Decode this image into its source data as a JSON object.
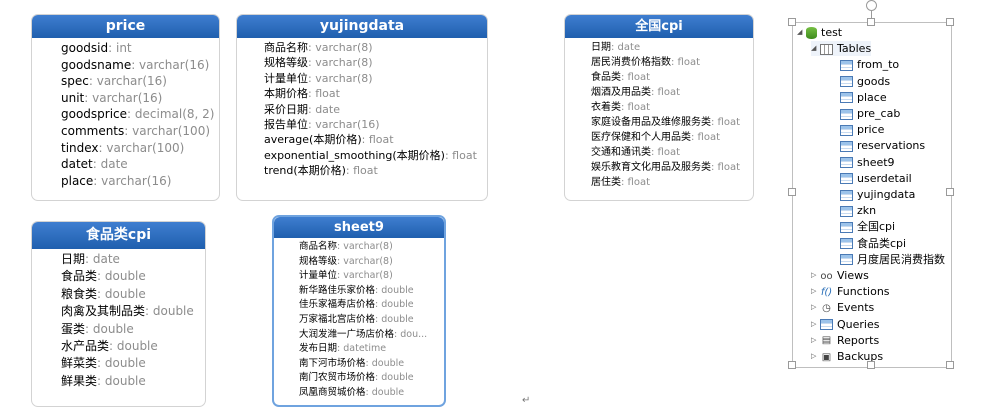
{
  "tables": {
    "price": {
      "title": "price",
      "rows": [
        {
          "n": "goodsid",
          "t": ": int"
        },
        {
          "n": "goodsname",
          "t": ": varchar(16)"
        },
        {
          "n": "spec",
          "t": ": varchar(16)"
        },
        {
          "n": "unit",
          "t": ": varchar(16)"
        },
        {
          "n": "goodsprice",
          "t": ": decimal(8, 2)"
        },
        {
          "n": "comments",
          "t": ": varchar(100)"
        },
        {
          "n": "tindex",
          "t": ": varchar(100)"
        },
        {
          "n": "datet",
          "t": ": date"
        },
        {
          "n": "place",
          "t": ": varchar(16)"
        }
      ]
    },
    "yujingdata": {
      "title": "yujingdata",
      "rows": [
        {
          "n": "商品名称",
          "t": ": varchar(8)"
        },
        {
          "n": "规格等级",
          "t": ": varchar(8)"
        },
        {
          "n": "计量单位",
          "t": ": varchar(8)"
        },
        {
          "n": "本期价格",
          "t": ": float"
        },
        {
          "n": "采价日期",
          "t": ": date"
        },
        {
          "n": "报告单位",
          "t": ": varchar(16)"
        },
        {
          "n": "average(本期价格)",
          "t": ": float"
        },
        {
          "n": "exponential_smoothing(本期价格)",
          "t": ": float"
        },
        {
          "n": "trend(本期价格)",
          "t": ": float"
        }
      ]
    },
    "cpi": {
      "title": "全国cpi",
      "rows": [
        {
          "n": "日期",
          "t": ": date"
        },
        {
          "n": "居民消费价格指数",
          "t": ": float"
        },
        {
          "n": "食品类",
          "t": ": float"
        },
        {
          "n": "烟酒及用品类",
          "t": ": float"
        },
        {
          "n": "衣着类",
          "t": ": float"
        },
        {
          "n": "家庭设备用品及维修服务类",
          "t": ": float"
        },
        {
          "n": "医疗保健和个人用品类",
          "t": ": float"
        },
        {
          "n": "交通和通讯类",
          "t": ": float"
        },
        {
          "n": "娱乐教育文化用品及服务类",
          "t": ": float"
        },
        {
          "n": "居住类",
          "t": ": float"
        }
      ]
    },
    "foodcpi": {
      "title": "食品类cpi",
      "rows": [
        {
          "n": "日期",
          "t": ": date"
        },
        {
          "n": "食品类",
          "t": ": double"
        },
        {
          "n": "粮食类",
          "t": ": double"
        },
        {
          "n": "肉禽及其制品类",
          "t": ": double"
        },
        {
          "n": "蛋类",
          "t": ": double"
        },
        {
          "n": "水产品类",
          "t": ": double"
        },
        {
          "n": "鲜菜类",
          "t": ": double"
        },
        {
          "n": "鲜果类",
          "t": ": double"
        }
      ]
    },
    "sheet9": {
      "title": "sheet9",
      "rows": [
        {
          "n": "商品名称",
          "t": ": varchar(8)"
        },
        {
          "n": "规格等级",
          "t": ": varchar(8)"
        },
        {
          "n": "计量单位",
          "t": ": varchar(8)"
        },
        {
          "n": "新华路佳乐家价格",
          "t": ": double"
        },
        {
          "n": "佳乐家福寿店价格",
          "t": ": double"
        },
        {
          "n": "万家福北宫店价格",
          "t": ": double"
        },
        {
          "n": "大润发潍一广场店价格",
          "t": ": dou..."
        },
        {
          "n": "发布日期",
          "t": ": datetime"
        },
        {
          "n": "南下河市场价格",
          "t": ": double"
        },
        {
          "n": "南门农贸市场价格",
          "t": ": double"
        },
        {
          "n": "凤凰商贸城价格",
          "t": ": double"
        }
      ]
    }
  },
  "tree": {
    "db": "test",
    "tables_label": "Tables",
    "tables": [
      "from_to",
      "goods",
      "place",
      "pre_cab",
      "price",
      "reservations",
      "sheet9",
      "userdetail",
      "yujingdata",
      "zkn",
      "全国cpi",
      "食品类cpi",
      "月度居民消费指数"
    ],
    "others": [
      {
        "label": "Views",
        "icon": "oo"
      },
      {
        "label": "Functions",
        "icon": "f()"
      },
      {
        "label": "Events",
        "icon": "clock"
      },
      {
        "label": "Queries",
        "icon": "query"
      },
      {
        "label": "Reports",
        "icon": "report"
      },
      {
        "label": "Backups",
        "icon": "backup"
      }
    ]
  },
  "return_mark": "↵"
}
